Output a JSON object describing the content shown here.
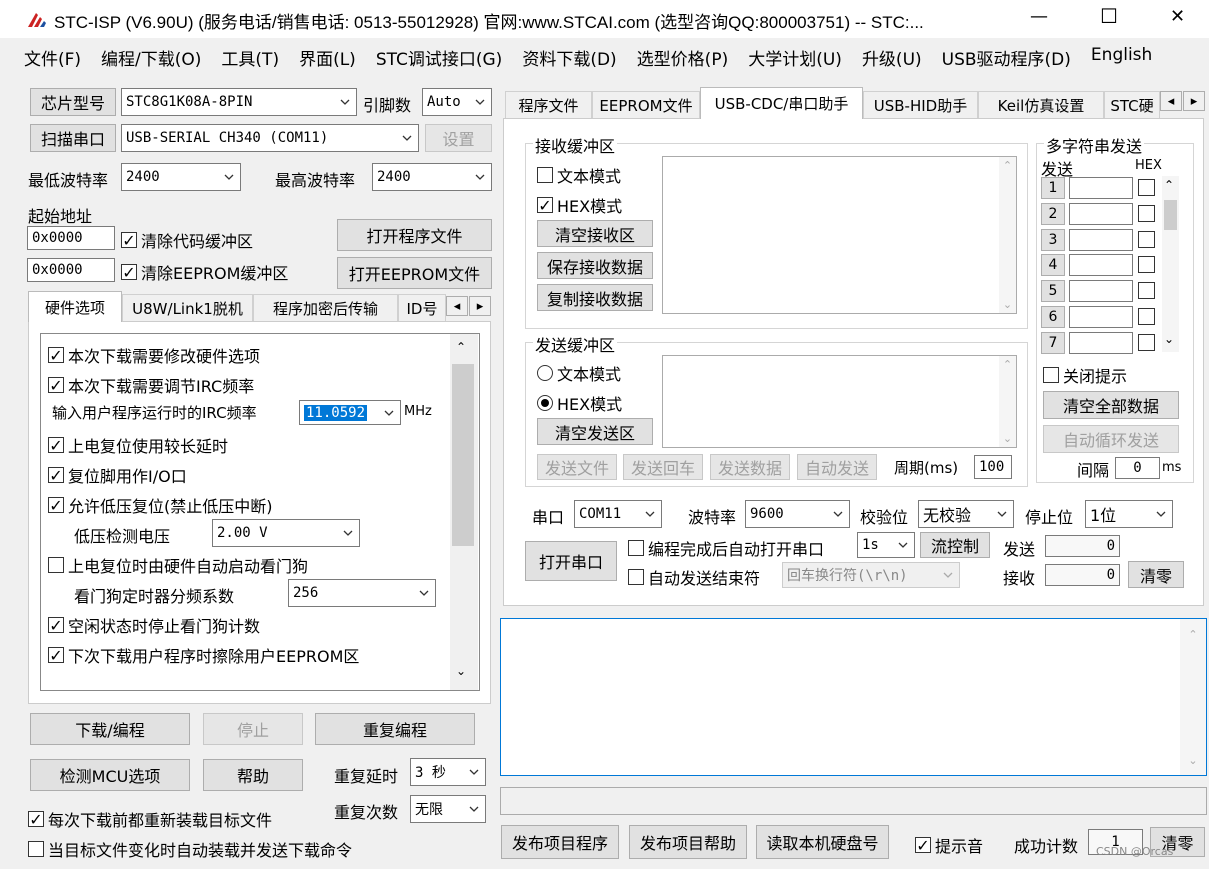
{
  "window": {
    "title": "STC-ISP (V6.90U) (服务电话/销售电话: 0513-55012928) 官网:www.STCAI.com  (选型咨询QQ:800003751) -- STC:...",
    "minimize": "—",
    "maximize": "☐",
    "close": "✕"
  },
  "menu": [
    "文件(F)",
    "编程/下载(O)",
    "工具(T)",
    "界面(L)",
    "STC调试接口(G)",
    "资料下载(D)",
    "选型价格(P)",
    "大学计划(U)",
    "升级(U)",
    "USB驱动程序(D)",
    "English"
  ],
  "left": {
    "chip_btn": "芯片型号",
    "chip_value": "STC8G1K08A-8PIN",
    "pin_label": "引脚数",
    "pin_value": "Auto",
    "scan_btn": "扫描串口",
    "port_value": "USB-SERIAL CH340 (COM11)",
    "settings_btn": "设置",
    "min_baud_label": "最低波特率",
    "min_baud": "2400",
    "max_baud_label": "最高波特率",
    "max_baud": "2400",
    "start_addr_label": "起始地址",
    "addr1": "0x0000",
    "clear_code": "清除代码缓冲区",
    "open_prog": "打开程序文件",
    "addr2": "0x0000",
    "clear_eeprom": "清除EEPROM缓冲区",
    "open_eeprom": "打开EEPROM文件",
    "tabs": [
      "硬件选项",
      "U8W/Link1脱机",
      "程序加密后传输",
      "ID号"
    ],
    "hw": {
      "opt1": "本次下载需要修改硬件选项",
      "opt2": "本次下载需要调节IRC频率",
      "irc_label": "输入用户程序运行时的IRC频率",
      "irc_value": "11.0592",
      "irc_unit": "MHz",
      "opt3": "上电复位使用较长延时",
      "opt4": "复位脚用作I/O口",
      "opt5": "允许低压复位(禁止低压中断)",
      "lv_label": "低压检测电压",
      "lv_value": "2.00 V",
      "opt6": "上电复位时由硬件自动启动看门狗",
      "wdt_label": "看门狗定时器分频系数",
      "wdt_value": "256",
      "opt7": "空闲状态时停止看门狗计数",
      "opt8": "下次下载用户程序时擦除用户EEPROM区"
    },
    "download_btn": "下载/编程",
    "stop_btn": "停止",
    "reprogram_btn": "重复编程",
    "detect_btn": "检测MCU选项",
    "help_btn": "帮助",
    "repeat_delay_label": "重复延时",
    "repeat_delay": "3 秒",
    "repeat_count_label": "重复次数",
    "repeat_count": "无限",
    "reload_each": "每次下载前都重新装载目标文件",
    "auto_reload": "当目标文件变化时自动装载并发送下载命令"
  },
  "right": {
    "tabs": [
      "程序文件",
      "EEPROM文件",
      "USB-CDC/串口助手",
      "USB-HID助手",
      "Keil仿真设置",
      "STC硬"
    ],
    "recv_group": "接收缓冲区",
    "text_mode": "文本模式",
    "hex_mode": "HEX模式",
    "clear_recv": "清空接收区",
    "save_recv": "保存接收数据",
    "copy_recv": "复制接收数据",
    "send_group": "发送缓冲区",
    "clear_send": "清空发送区",
    "send_file": "发送文件",
    "send_enter": "发送回车",
    "send_data": "发送数据",
    "auto_send": "自动发送",
    "period_label": "周期(ms)",
    "period_value": "100",
    "multi_group": "多字符串发送",
    "multi_send": "发送",
    "multi_hex": "HEX",
    "multi_rows": [
      "1",
      "2",
      "3",
      "4",
      "5",
      "6",
      "7"
    ],
    "close_tip": "关闭提示",
    "clear_all": "清空全部数据",
    "auto_loop": "自动循环发送",
    "interval_label": "间隔",
    "interval_value": "0",
    "interval_unit": "ms",
    "port_label": "串口",
    "port_value": "COM11",
    "baud_label": "波特率",
    "baud_value": "9600",
    "parity_label": "校验位",
    "parity_value": "无校验",
    "stop_label": "停止位",
    "stop_value": "1位",
    "open_port": "打开串口",
    "auto_open": "编程完成后自动打开串口",
    "auto_open_delay": "1s",
    "flow_ctrl": "流控制",
    "sent_label": "发送",
    "sent_value": "0",
    "auto_end": "自动发送结束符",
    "end_char": "回车换行符(\\r\\n)",
    "recv_label": "接收",
    "recv_value": "0",
    "clear_count": "清零",
    "publish_prog": "发布项目程序",
    "publish_help": "发布项目帮助",
    "read_disk": "读取本机硬盘号",
    "beep": "提示音",
    "success_label": "成功计数",
    "success_value": "1",
    "clear_success": "清零",
    "watermark": "CSDN @Orcas"
  },
  "colors": {
    "title_bg": "#ffffff",
    "accent": "#0078d7",
    "highlight": "#0078d7"
  }
}
